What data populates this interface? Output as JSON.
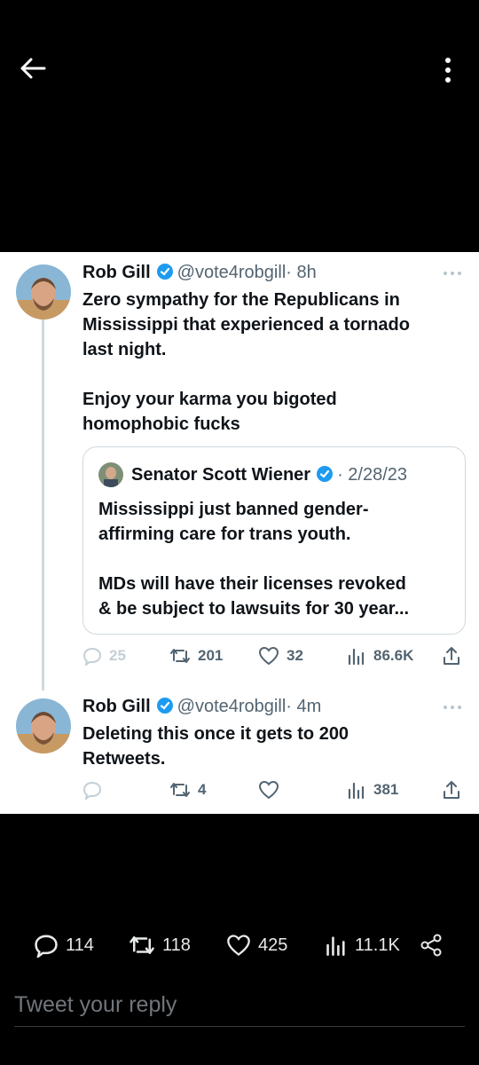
{
  "tweet": {
    "author_name": "Rob Gill",
    "author_handle": "@vote4robgill",
    "time": "· 8h",
    "text": "Zero sympathy for the Republicans in\nMississippi that experienced a tornado\nlast night.\n\nEnjoy your karma you bigoted\nhomophobic fucks",
    "stats": {
      "replies": "25",
      "retweets": "201",
      "likes": "32",
      "views": "86.6K"
    }
  },
  "quoted": {
    "author_name": "Senator Scott Wiener",
    "time": "· 2/28/23",
    "text": "Mississippi just banned gender-\naffirming care for trans youth.\n\nMDs will have their licenses revoked\n& be subject to lawsuits for 30 year..."
  },
  "reply_tweet": {
    "author_name": "Rob Gill",
    "author_handle": "@vote4robgill",
    "time": "· 4m",
    "text": "Deleting this once it gets to 200\nRetweets.",
    "stats": {
      "retweets": "4",
      "views": "381"
    }
  },
  "bottom_bar": {
    "replies": "114",
    "retweets": "118",
    "likes": "425",
    "views": "11.1K"
  },
  "reply_box": {
    "placeholder": "Tweet your reply"
  },
  "colors": {
    "verified": "#1d9bf0",
    "text": "#0f1419",
    "muted": "#536471"
  },
  "icons": [
    "back-arrow-icon",
    "more-vertical-icon",
    "more-horizontal-icon",
    "verified-badge-icon",
    "reply-icon",
    "retweet-icon",
    "like-icon",
    "views-icon",
    "share-icon"
  ]
}
